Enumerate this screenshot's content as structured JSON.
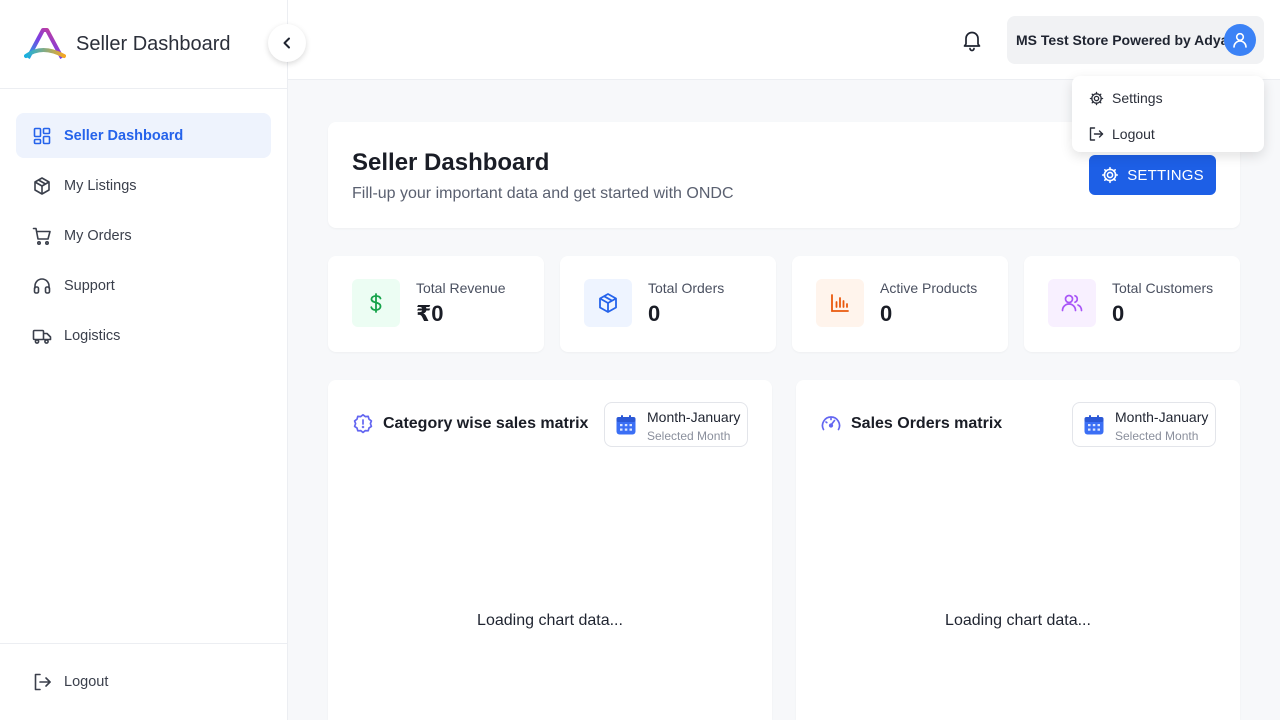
{
  "brand": {
    "title": "Seller Dashboard"
  },
  "sidebar": {
    "items": [
      {
        "label": "Seller Dashboard",
        "icon": "grid-icon",
        "active": true
      },
      {
        "label": "My Listings",
        "icon": "box-icon"
      },
      {
        "label": "My Orders",
        "icon": "cart-icon"
      },
      {
        "label": "Support",
        "icon": "headset-icon"
      },
      {
        "label": "Logistics",
        "icon": "truck-icon"
      }
    ],
    "logout_label": "Logout"
  },
  "topbar": {
    "user_name": "MS Test Store Powered by Adya"
  },
  "user_menu": {
    "settings_label": "Settings",
    "logout_label": "Logout"
  },
  "header": {
    "title": "Seller Dashboard",
    "subtitle": "Fill-up your important data and get started with ONDC",
    "settings_button": "SETTINGS"
  },
  "stats": [
    {
      "label": "Total Revenue",
      "value": "₹0",
      "icon": "dollar-icon",
      "color": "#16a34a",
      "bg": "#ecfdf3"
    },
    {
      "label": "Total Orders",
      "value": "0",
      "icon": "package-icon",
      "color": "#2563eb",
      "bg": "#eef4ff"
    },
    {
      "label": "Active Products",
      "value": "0",
      "icon": "bar-chart-icon",
      "color": "#ea580c",
      "bg": "#fff4ec"
    },
    {
      "label": "Total Customers",
      "value": "0",
      "icon": "users-icon",
      "color": "#a855f7",
      "bg": "#f8f0ff"
    }
  ],
  "charts": [
    {
      "title": "Category wise sales matrix",
      "month": "Month-January",
      "month_caption": "Selected Month",
      "loading": "Loading chart data..."
    },
    {
      "title": "Sales Orders matrix",
      "month": "Month-January",
      "month_caption": "Selected Month",
      "loading": "Loading chart data..."
    }
  ],
  "colors": {
    "accent": "#1d5fe6",
    "active_nav_bg": "#eef3fd"
  }
}
